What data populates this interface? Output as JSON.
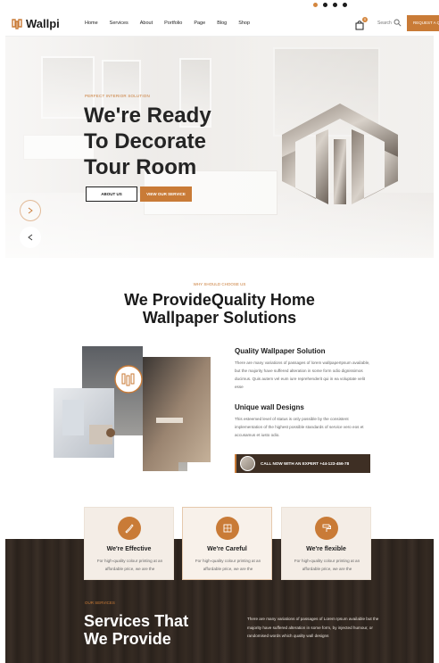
{
  "brand": {
    "name": "Wallpi",
    "accent": "#c97b37",
    "dark": "#2f2620"
  },
  "topbar": {
    "dots": [
      "#d4863e",
      "#1c1c1c",
      "#1c1c1c",
      "#1c1c1c"
    ]
  },
  "nav": {
    "items": [
      {
        "label": "Home",
        "caret": ""
      },
      {
        "label": "Services",
        "caret": ""
      },
      {
        "label": "About",
        "caret": ""
      },
      {
        "label": "Portfolio",
        "caret": ""
      },
      {
        "label": "Page",
        "caret": ""
      },
      {
        "label": "Blog",
        "caret": ""
      },
      {
        "label": "Shop",
        "caret": ""
      }
    ],
    "cart_count": "0",
    "search_label": "Search",
    "request_label": "REQUEST A QUOTE"
  },
  "hero": {
    "eyebrow": "PERFECT INTERIOR SOLUTION",
    "title_line1": "We're Ready",
    "title_line2": "To Decorate",
    "title_line3": "Tour Room",
    "about_btn": "ABOUT US",
    "service_btn": "VIEW OUR SERVICE"
  },
  "why": {
    "eyebrow": "WHY SHOULD CHOOSE US",
    "title_line1": "We ProvideQuality Home",
    "title_line2": "Wallpaper Solutions",
    "features": [
      {
        "title": "Quality Wallpaper Solution",
        "text": "There are many variations of passages of lorem wallpaperIpsum available, but the majority have suffered alteration in some form odio dignissimos ducimus. Quis autem vel eum iure reprehenderit qui in ea voluptate velit esse"
      },
      {
        "title": "Unique wall Designs",
        "text": "This esteemed level of status is only possible by the consistent implementation of the highest possible standards of service vero eos et accusamus et iusto odio."
      }
    ],
    "cta": "CALL NOW WITH AN EXPERT +44-123-456-78"
  },
  "cards": [
    {
      "title": "We're Effective",
      "text": "For high-quality colour printing at an affordable price, we are the",
      "icon": "brush-icon"
    },
    {
      "title": "We're Careful",
      "text": "For high-quality colour printing at an affordable price, we are the",
      "icon": "blueprint-icon"
    },
    {
      "title": "We're flexible",
      "text": "For high-quality colour printing at an affordable price, we are the",
      "icon": "paint-roller-icon"
    }
  ],
  "services": {
    "eyebrow": "OUR SERVICES",
    "title_line1": "Services That",
    "title_line2": "We Provide",
    "text": "There are many variations of passages of Lorem Ipsum available but the majority have suffered alteration in some form, by injected humour, or randomised words which quality wall designs"
  }
}
